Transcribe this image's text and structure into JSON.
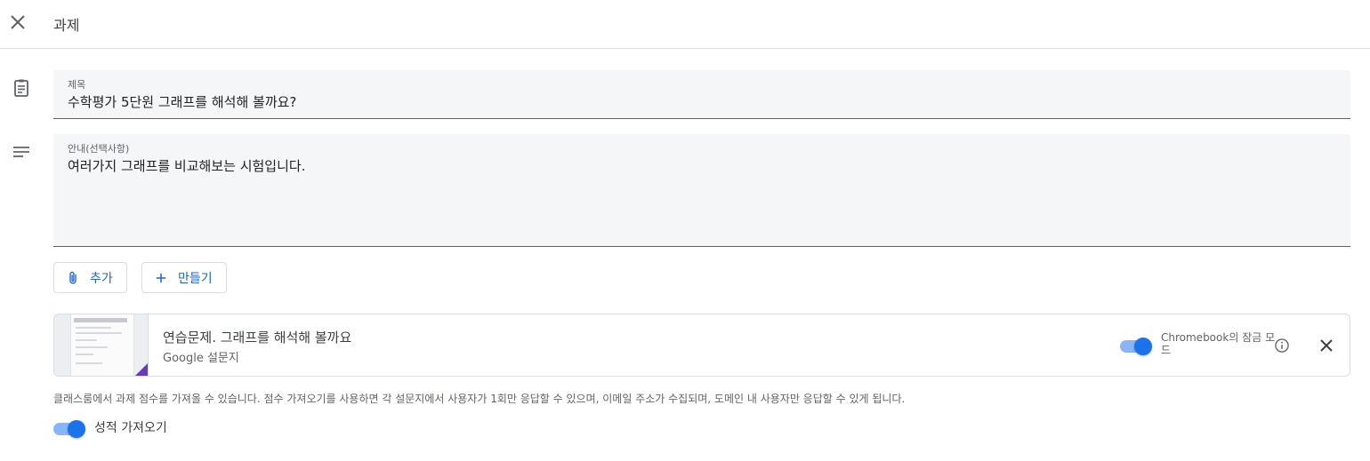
{
  "header": {
    "title": "과제"
  },
  "title_field": {
    "label": "제목",
    "value": "수학평가 5단원 그래프를 해석해 볼까요?"
  },
  "description_field": {
    "label": "안내(선택사항)",
    "value": "여러가지 그래프를 비교해보는 시험입니다."
  },
  "buttons": {
    "add_label": "추가",
    "create_label": "만들기"
  },
  "attachment": {
    "title": "연습문제. 그래프를 해석해 볼까요",
    "subtitle": "Google 설문지",
    "lock_mode_label": "Chromebook의 잠금 모드",
    "lock_mode_on": true
  },
  "grade_import": {
    "notice": "클래스룸에서 과제 점수를 가져올 수 있습니다. 점수 가져오기를 사용하면 각 설문지에서 사용자가 1회만 응답할 수 있으며, 이메일 주소가 수집되며, 도메인 내 사용자만 응답할 수 있게 됩니다.",
    "label": "성적 가져오기",
    "on": true
  },
  "colors": {
    "accent": "#1a73e8",
    "accent_light": "#8ab4f8",
    "forms_purple": "#673ab7",
    "field_bg": "#f5f6f8"
  }
}
